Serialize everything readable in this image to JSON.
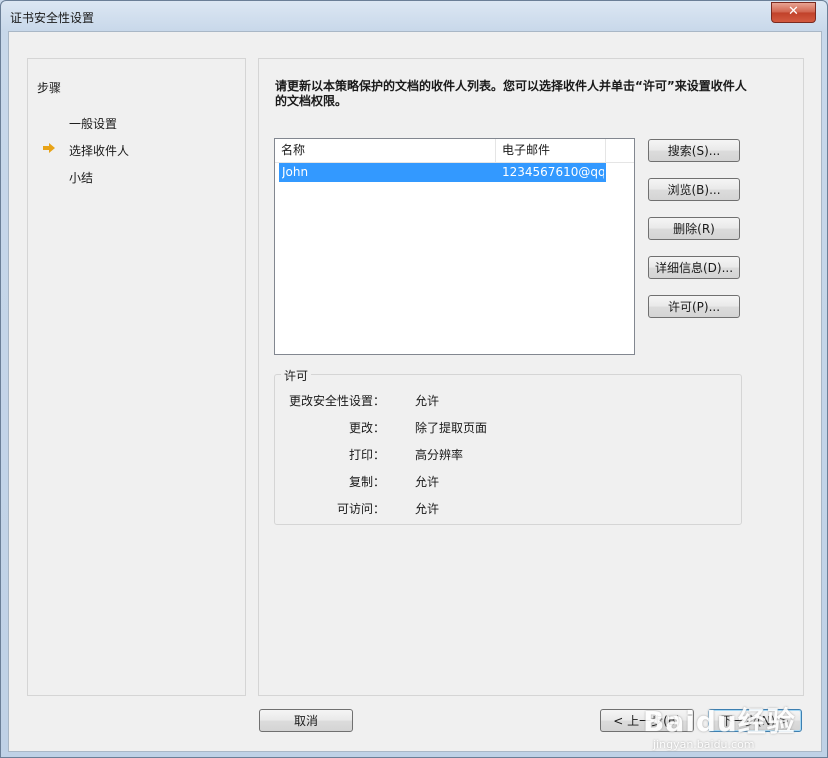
{
  "window": {
    "title": "证书安全性设置",
    "close_glyph": "✕"
  },
  "steps": {
    "title": "步骤",
    "items": [
      {
        "label": "一般设置"
      },
      {
        "label": "选择收件人"
      },
      {
        "label": "小结"
      }
    ],
    "current_index": 1
  },
  "main": {
    "instructions": "请更新以本策略保护的文档的收件人列表。您可以选择收件人并单击“许可”来设置收件人的文档权限。",
    "list": {
      "columns": [
        "名称",
        "电子邮件"
      ],
      "rows": [
        {
          "name": "John",
          "email": "1234567610@qq...."
        }
      ]
    },
    "buttons": {
      "search": "搜索(S)...",
      "browse": "浏览(B)...",
      "delete": "删除(R)",
      "details": "详细信息(D)...",
      "permissions": "许可(P)..."
    },
    "permissions": {
      "title": "许可",
      "rows": [
        {
          "label": "更改安全性设置：",
          "value": "允许"
        },
        {
          "label": "更改：",
          "value": "除了提取页面"
        },
        {
          "label": "打印：",
          "value": "高分辨率"
        },
        {
          "label": "复制：",
          "value": "允许"
        },
        {
          "label": "可访问：",
          "value": "允许"
        }
      ]
    }
  },
  "footer": {
    "cancel": "取消",
    "back": "< 上一步(B)",
    "next": "下一步(N) >"
  },
  "watermark": {
    "main": "Baidu经验",
    "sub": "jingyan.baidu.com"
  },
  "colors": {
    "selection": "#3399ff",
    "arrow": "#e8a317"
  }
}
